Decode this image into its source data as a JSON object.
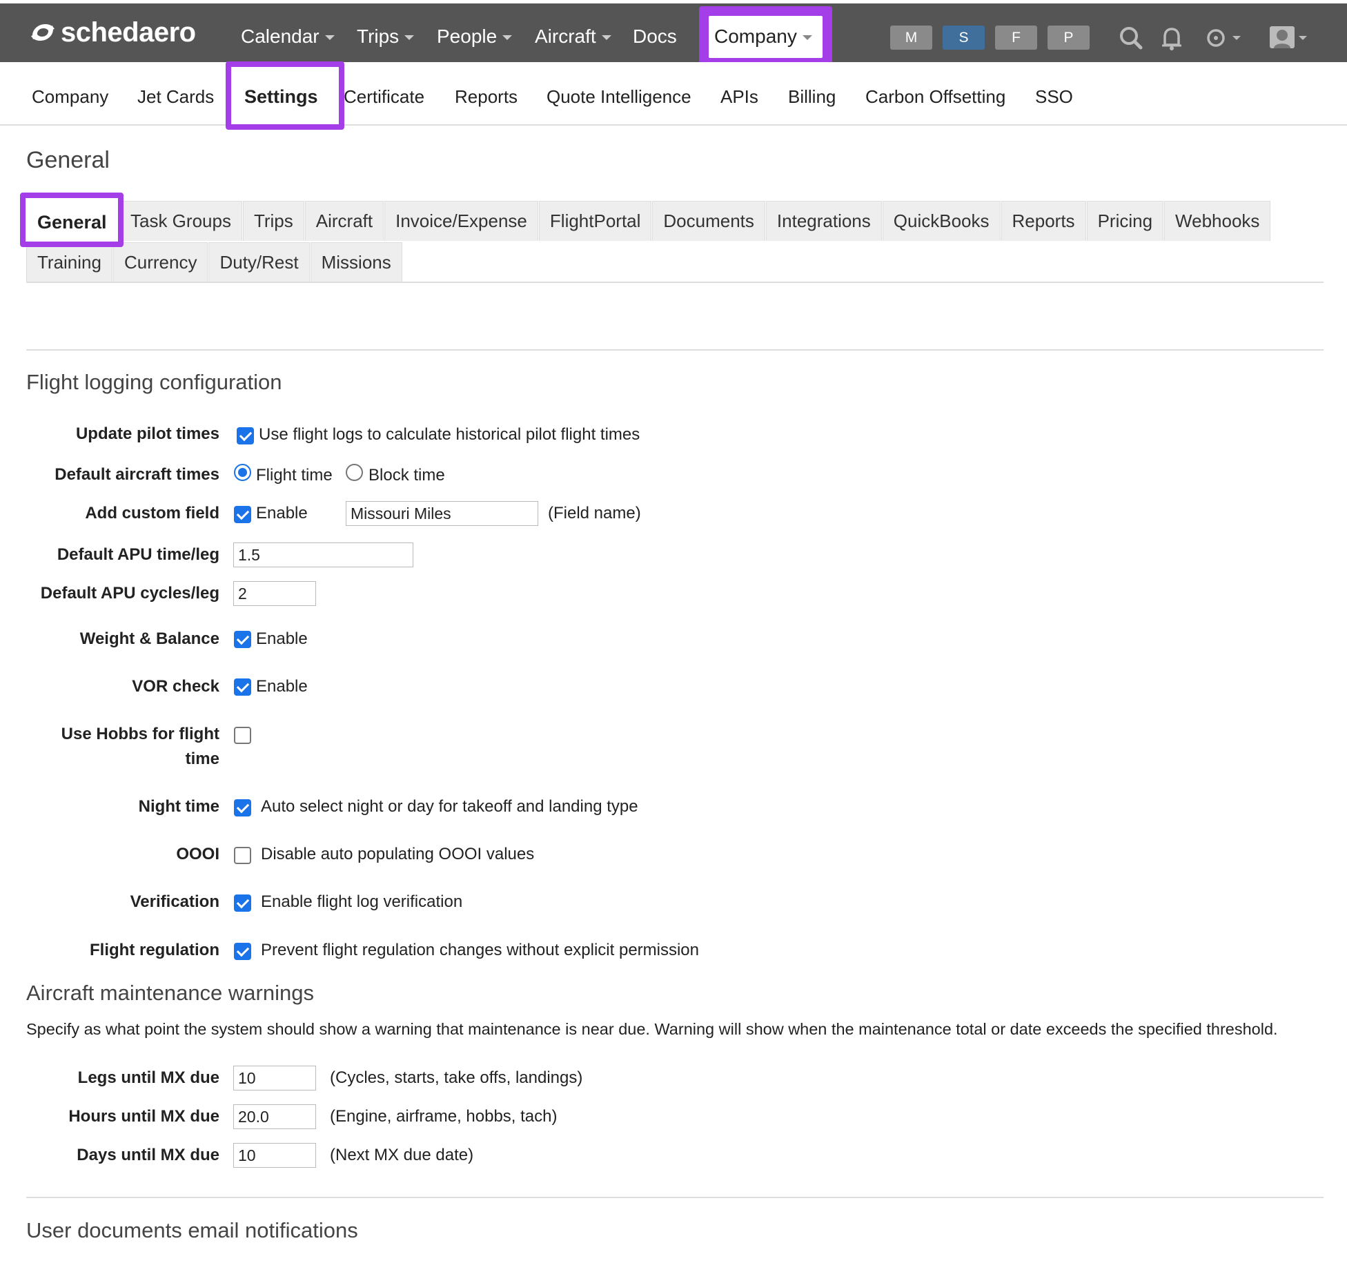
{
  "brand": {
    "name": "schedaero"
  },
  "topnav": {
    "items": [
      {
        "label": "Calendar"
      },
      {
        "label": "Trips"
      },
      {
        "label": "People"
      },
      {
        "label": "Aircraft"
      },
      {
        "label": "Docs"
      }
    ],
    "company": "Company",
    "pills": [
      "M",
      "S",
      "F",
      "P"
    ],
    "pill_colors": [
      "#8a8a8a",
      "#3f6f9a",
      "#8a8a8a",
      "#8a8a8a"
    ],
    "highlight_color": "#a33ee8",
    "icons": [
      "search-icon",
      "bell-icon",
      "help-icon",
      "user-avatar-icon"
    ]
  },
  "subnav": {
    "items": [
      "Company",
      "Jet Cards",
      "Settings",
      "Certificate",
      "Reports",
      "Quote Intelligence",
      "APIs",
      "Billing",
      "Carbon Offsetting",
      "SSO"
    ],
    "active": "Settings"
  },
  "page": {
    "title": "General"
  },
  "tabs": {
    "row1": [
      "General",
      "Task Groups",
      "Trips",
      "Aircraft",
      "Invoice/Expense",
      "FlightPortal",
      "Documents",
      "Integrations",
      "QuickBooks",
      "Reports",
      "Pricing",
      "Webhooks"
    ],
    "row2": [
      "Training",
      "Currency",
      "Duty/Rest",
      "Missions"
    ],
    "active": "General"
  },
  "flight_logging": {
    "title": "Flight logging configuration",
    "update_pilot_times": {
      "label": "Update pilot times",
      "checked": true,
      "text": "Use flight logs to calculate historical pilot flight times"
    },
    "default_aircraft_times": {
      "label": "Default aircraft times",
      "options": [
        "Flight time",
        "Block time"
      ],
      "selected": "Flight time"
    },
    "custom_field": {
      "label": "Add custom field",
      "checked": true,
      "enable": "Enable",
      "value": "Missouri Miles",
      "hint": "(Field name)"
    },
    "apu_time": {
      "label": "Default APU time/leg",
      "value": "1.5"
    },
    "apu_cycles": {
      "label": "Default APU cycles/leg",
      "value": "2"
    },
    "weight_balance": {
      "label": "Weight & Balance",
      "checked": true,
      "text": "Enable"
    },
    "vor_check": {
      "label": "VOR check",
      "checked": true,
      "text": "Enable"
    },
    "hobbs": {
      "label_line1": "Use Hobbs for flight",
      "label_line2": "time",
      "checked": false
    },
    "night_time": {
      "label": "Night time",
      "checked": true,
      "text": "Auto select night or day for takeoff and landing type"
    },
    "oooi": {
      "label": "OOOI",
      "checked": false,
      "text": "Disable auto populating OOOI values"
    },
    "verification": {
      "label": "Verification",
      "checked": true,
      "text": "Enable flight log verification"
    },
    "regulation": {
      "label": "Flight regulation",
      "checked": true,
      "text": "Prevent flight regulation changes without explicit permission"
    }
  },
  "maintenance": {
    "title": "Aircraft maintenance warnings",
    "description": "Specify as what point the system should show a warning that maintenance is near due. Warning will show when the maintenance total or date exceeds the specified threshold.",
    "legs": {
      "label": "Legs until MX due",
      "value": "10",
      "hint": "(Cycles, starts, take offs, landings)"
    },
    "hours": {
      "label": "Hours until MX due",
      "value": "20.0",
      "hint": "(Engine, airframe, hobbs, tach)"
    },
    "days": {
      "label": "Days until MX due",
      "value": "10",
      "hint": "(Next MX due date)"
    }
  },
  "user_docs": {
    "title": "User documents email notifications"
  }
}
